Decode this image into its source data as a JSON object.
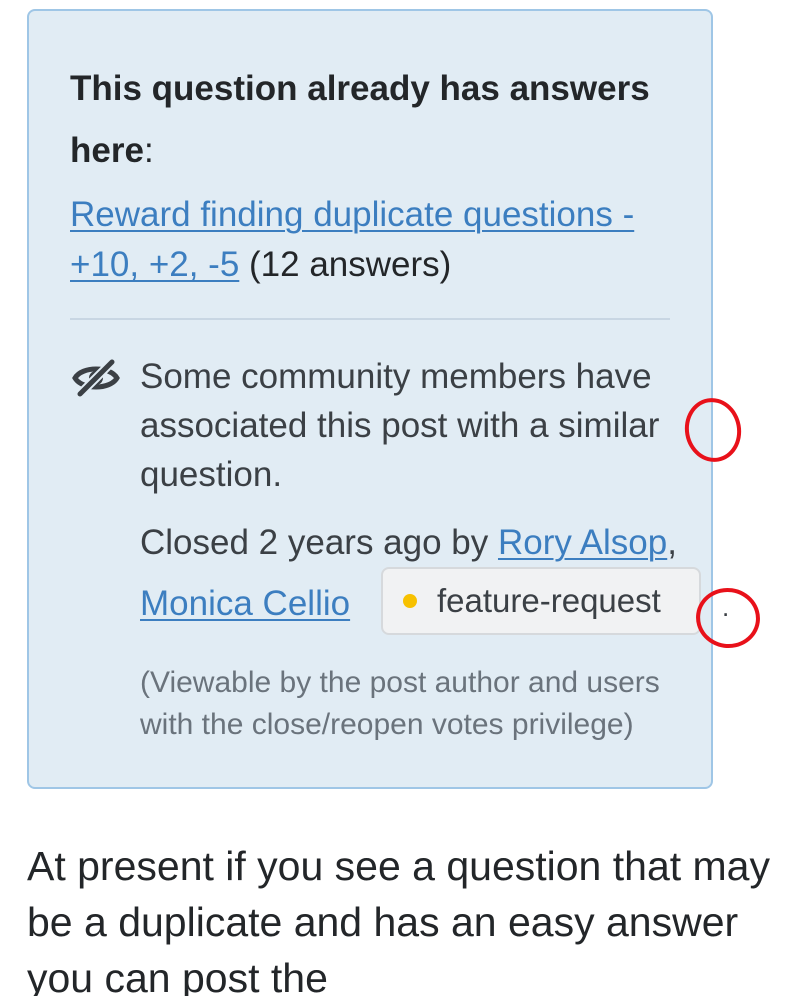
{
  "duplicate_notice": {
    "heading": "This question already has answers here",
    "heading_colon": ":",
    "link_text": "Reward finding duplicate questions - +10, +2, -5",
    "answer_count": "(12 answers)"
  },
  "community_notice": {
    "icon": "eye-slash-icon",
    "text": "Some community members have associated this post with a similar question.",
    "closed_prefix": "Closed 2 years ago by ",
    "closer_1": "Rory Alsop",
    "separator": ",",
    "closer_2": "Monica Cellio",
    "tag": "feature-request",
    "period": ".",
    "viewable_note": "(Viewable by the post author and users with the close/reopen votes privilege)"
  },
  "post_body": {
    "text": "At present if you see a question that may be a duplicate and has an easy answer you can post the"
  },
  "colors": {
    "notice_background": "#e1ecf4",
    "notice_border": "#9fc6e6",
    "link": "#3c7ec0",
    "tag_dot": "#f7c100",
    "annotation": "#e8111a"
  }
}
